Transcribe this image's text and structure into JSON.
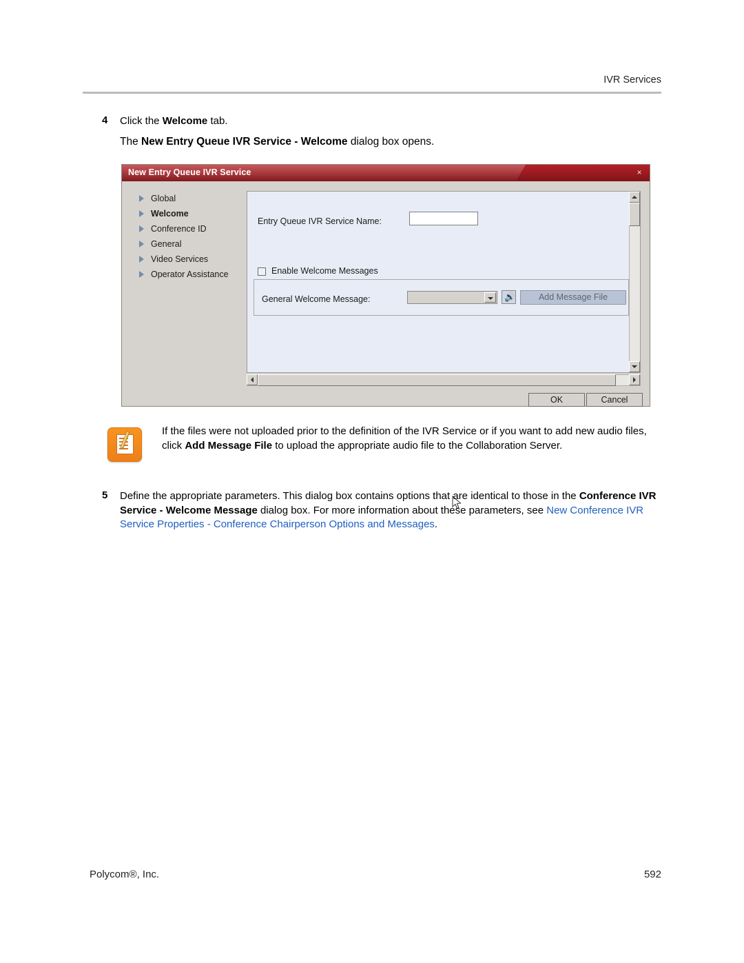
{
  "header": {
    "section_title": "IVR Services"
  },
  "steps": [
    {
      "number": "4",
      "text_parts": [
        {
          "t": "Click the ",
          "style": "normal"
        },
        {
          "t": "Welcome",
          "style": "bold"
        },
        {
          "t": " tab.",
          "style": "normal"
        }
      ],
      "plain": "Click the Welcome tab.",
      "subline": {
        "pre": "The ",
        "bold": "New Entry Queue IVR Service - Welcome",
        "post": " dialog box opens."
      }
    },
    {
      "number": "5",
      "line1_pre": "Define the appropriate parameters. This dialog box contains options that are identical to those in the",
      "line2_bold": "Conference IVR Service - Welcome Message",
      "line2_post": " dialog box. For more information about these",
      "line3_pre": "parameters, see ",
      "line3_link": "New Conference IVR Service Properties - Conference Chairperson Options and",
      "line4_link": "Messages",
      "line4_post": "."
    }
  ],
  "dialog": {
    "title": "New Entry Queue IVR Service",
    "close_label": "×",
    "nav_items": [
      {
        "label": "Global",
        "selected": false
      },
      {
        "label": "Welcome",
        "selected": true
      },
      {
        "label": "Conference ID",
        "selected": false
      },
      {
        "label": "General",
        "selected": false
      },
      {
        "label": "Video Services",
        "selected": false
      },
      {
        "label": "Operator Assistance",
        "selected": false
      }
    ],
    "fields": {
      "service_name_label": "Entry Queue IVR Service Name:",
      "service_name_value": "",
      "enable_welcome_label": "Enable Welcome Messages",
      "enable_welcome_checked": false,
      "general_welcome_label": "General Welcome Message:",
      "general_welcome_value": "",
      "add_message_file_label": "Add Message File"
    },
    "buttons": {
      "ok": "OK",
      "cancel": "Cancel"
    }
  },
  "note": {
    "line1_pre": "If the files were not uploaded prior to the definition of the IVR Service or if you want to add new audio",
    "line2_pre": "files, click ",
    "line2_bold": "Add Message File",
    "line2_post": " to upload the appropriate audio file to the Collaboration Server."
  },
  "footer": {
    "left": "Polycom®, Inc.",
    "right": "592"
  },
  "colors": {
    "title_bar_red": "#9d1b20",
    "link_blue": "#1f5fbf",
    "note_orange": "#f7941e",
    "rule_gray": "#b9bcbe"
  }
}
